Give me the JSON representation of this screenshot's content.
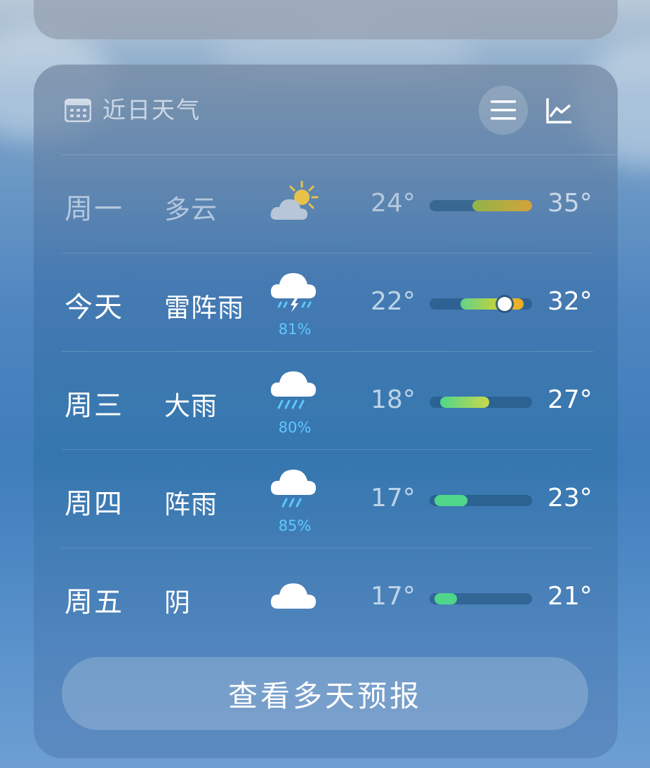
{
  "header": {
    "title": "近日天气",
    "calendar_icon": "calendar-icon",
    "list_view_icon": "list-icon",
    "chart_view_icon": "line-chart-icon"
  },
  "days": [
    {
      "day": "周一",
      "condition": "多云",
      "icon": "partly-sunny-icon",
      "precip": "",
      "low": "24°",
      "high": "35°",
      "bar_start": 0.42,
      "bar_end": 1.0,
      "past": true
    },
    {
      "day": "今天",
      "condition": "雷阵雨",
      "icon": "thunderstorm-icon",
      "precip": "81%",
      "low": "22°",
      "high": "32°",
      "bar_start": 0.3,
      "bar_end": 0.92,
      "past": false
    },
    {
      "day": "周三",
      "condition": "大雨",
      "icon": "heavy-rain-icon",
      "precip": "80%",
      "low": "18°",
      "high": "27°",
      "bar_start": 0.1,
      "bar_end": 0.58,
      "past": false
    },
    {
      "day": "周四",
      "condition": "阵雨",
      "icon": "shower-icon",
      "precip": "85%",
      "low": "17°",
      "high": "23°",
      "bar_start": 0.05,
      "bar_end": 0.37,
      "past": false
    },
    {
      "day": "周五",
      "condition": "阴",
      "icon": "cloud-icon",
      "precip": "",
      "low": "17°",
      "high": "21°",
      "bar_start": 0.05,
      "bar_end": 0.27,
      "past": false
    }
  ],
  "current_marker": {
    "position": 0.73
  },
  "footer": {
    "forecast_button": "查看多天预报"
  },
  "colors": {
    "precip": "#5ec8ff",
    "bar_warm": "#d6a23a",
    "bar_cool": "#4fd68a",
    "accent_orange": "#f5a623"
  }
}
